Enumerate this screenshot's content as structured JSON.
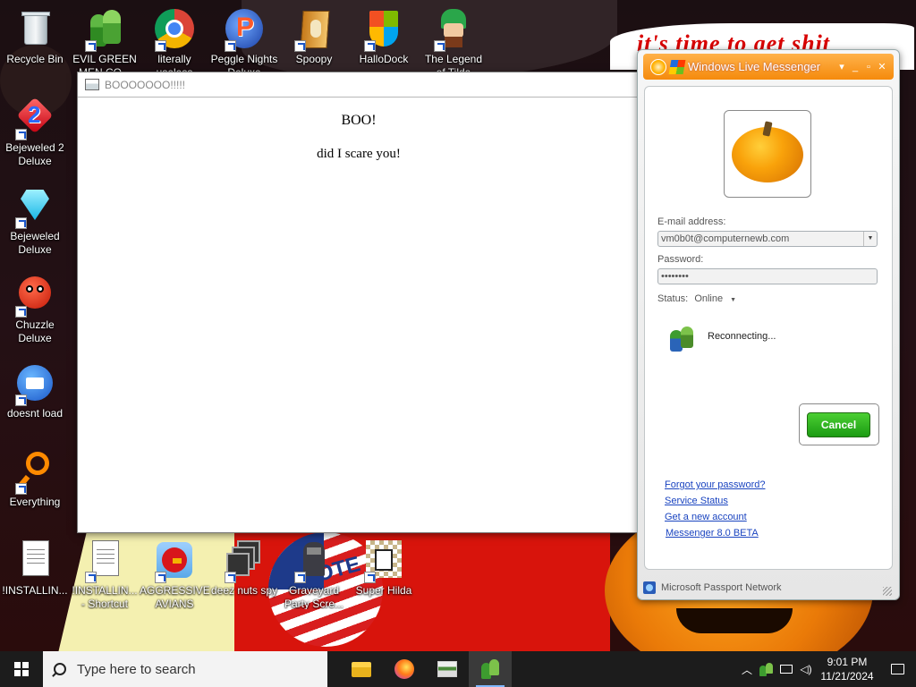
{
  "desktop": {
    "wallpaper_text": "it's time to get shit",
    "icons": [
      {
        "label": "Recycle Bin",
        "label2": ""
      },
      {
        "label": "EVIL GREEN",
        "label2": "MEN CO..."
      },
      {
        "label": "literally",
        "label2": "useless"
      },
      {
        "label": "Peggle Nights",
        "label2": "Deluxe"
      },
      {
        "label": "Spoopy",
        "label2": ""
      },
      {
        "label": "HalloDock",
        "label2": ""
      },
      {
        "label": "The Legend",
        "label2": "of Tilda"
      },
      {
        "label": "Bejeweled 2",
        "label2": "Deluxe"
      },
      {
        "label": "Bejeweled",
        "label2": "Deluxe"
      },
      {
        "label": "Chuzzle",
        "label2": "Deluxe"
      },
      {
        "label": "doesnt load",
        "label2": ""
      },
      {
        "label": "Everything",
        "label2": ""
      },
      {
        "label": "!INSTALLIN...",
        "label2": ""
      },
      {
        "label": "!INSTALLIN...",
        "label2": "- Shortcut"
      },
      {
        "label": "AGGRESSIVE",
        "label2": "AVIANS"
      },
      {
        "label": "deez nuts spy",
        "label2": ""
      },
      {
        "label": "Graveyard",
        "label2": "Party Scre..."
      },
      {
        "label": "Super Hilda",
        "label2": ""
      }
    ]
  },
  "boo_window": {
    "title": "BOOOOOOO!!!!!",
    "heading": "BOO!",
    "text": "did I scare you!"
  },
  "messenger": {
    "title": "Windows Live Messenger",
    "controls": {
      "menu": "▾",
      "minimize": "_",
      "maximize": "▫",
      "close": "✕"
    },
    "email_label": "E-mail address:",
    "email_value": "vm0b0t@computernewb.com",
    "password_label": "Password:",
    "password_value": "••••••••",
    "status_label": "Status:",
    "status_value": "Online",
    "reconnecting": "Reconnecting...",
    "cancel_label": "Cancel",
    "links": [
      "Forgot your password?",
      "Service Status",
      "Get a new account",
      "Messenger 8.0 BETA"
    ],
    "footer": "Microsoft Passport Network"
  },
  "taskbar": {
    "search_placeholder": "Type here to search",
    "apps": [
      "file-explorer-icon",
      "firefox-icon",
      "window-icon",
      "messenger-icon"
    ],
    "tray": [
      "chevron-up-icon",
      "messenger-tray-icon",
      "network-icon",
      "volume-icon"
    ],
    "time": "9:01 PM",
    "date": "11/21/2024"
  },
  "colors": {
    "messenger_orange": "#f58a0c",
    "cancel_green": "#1b9b12",
    "link_blue": "#1a44c0",
    "taskbar": "#1c1c1c"
  }
}
